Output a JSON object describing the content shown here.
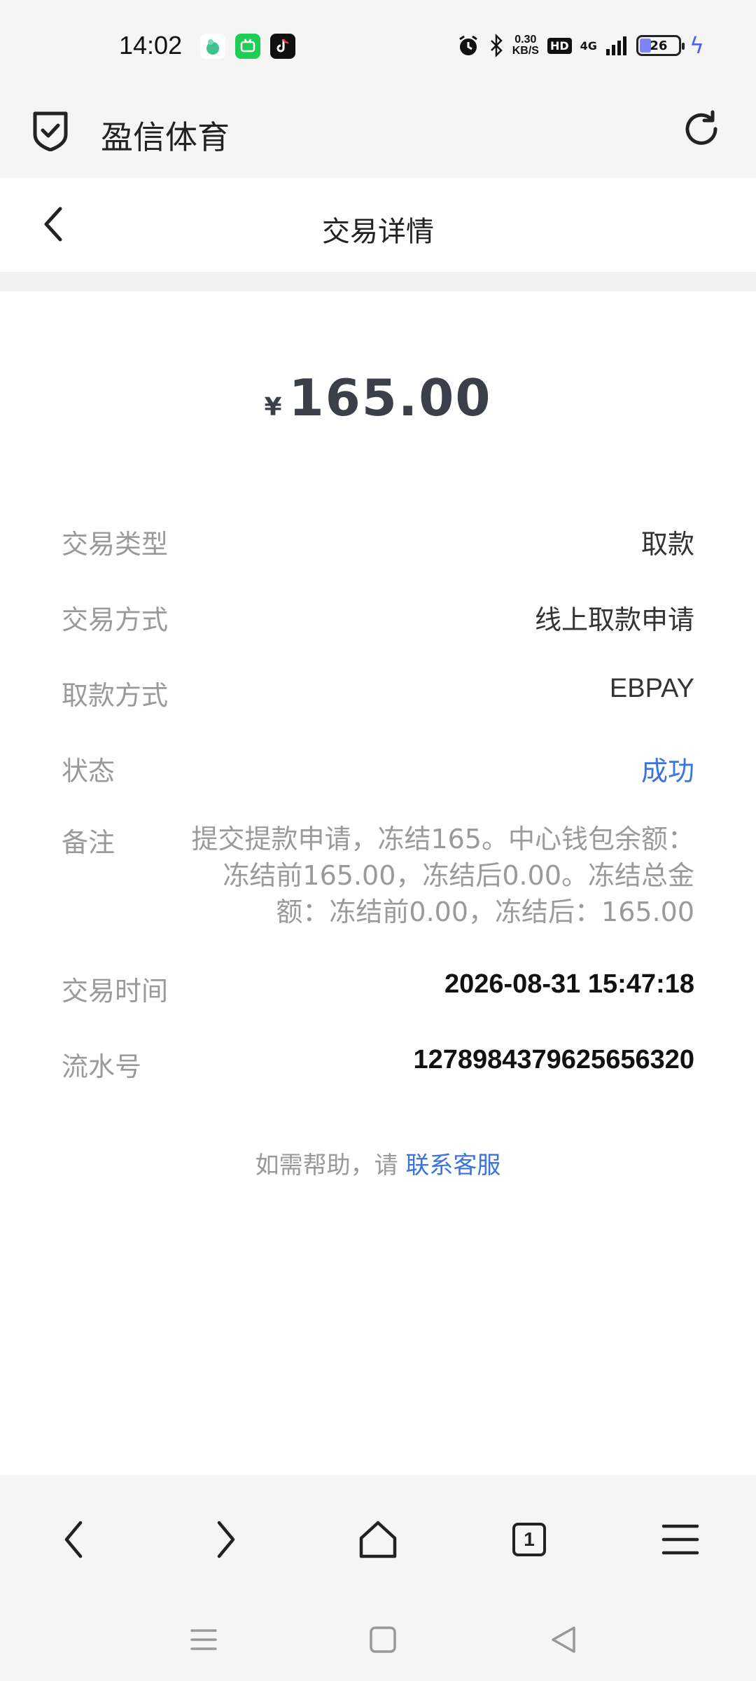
{
  "status_bar": {
    "time": "14:02",
    "net_speed_value": "0.30",
    "net_speed_unit": "KB/S",
    "hd": "HD",
    "signal": "4G",
    "battery": "26",
    "icons": [
      "app-icon-green-drop",
      "app-icon-green-square",
      "tiktok-icon",
      "alarm-icon",
      "bluetooth-icon",
      "signal-icon",
      "charging-icon"
    ]
  },
  "app_header": {
    "title": "盈信体育"
  },
  "page_header": {
    "title": "交易详情"
  },
  "transaction": {
    "currency": "¥",
    "amount": "165.00",
    "rows": [
      {
        "label": "交易类型",
        "value": "取款"
      },
      {
        "label": "交易方式",
        "value": "线上取款申请"
      },
      {
        "label": "取款方式",
        "value": "EBPAY"
      },
      {
        "label": "状态",
        "value": "成功"
      },
      {
        "label": "备注",
        "value": "提交提款申请，冻结165。中心钱包余额：冻结前165.00，冻结后0.00。冻结总金额：冻结前0.00，冻结后：165.00"
      },
      {
        "label": "交易时间",
        "value": "2026-08-31 15:47:18"
      },
      {
        "label": "流水号",
        "value": "1278984379625656320"
      }
    ]
  },
  "help": {
    "prefix": "如需帮助，请",
    "link": "联系客服"
  },
  "browser_toolbar": {
    "tab_count": "1"
  },
  "colors": {
    "accent": "#3b74e0",
    "amount": "#3a3f4a",
    "label": "#9a9a9a",
    "background": "#f5f5f5"
  }
}
